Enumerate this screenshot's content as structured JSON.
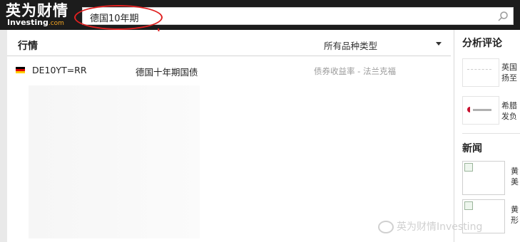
{
  "logo": {
    "chinese": "英为财情",
    "english": "Investing",
    "english_suffix": ".com"
  },
  "search": {
    "value": "德国10年期"
  },
  "markets": {
    "title": "行情",
    "type_filter": "所有品种类型",
    "results": [
      {
        "symbol": "DE10YT=RR",
        "name": "德国十年期国债",
        "type": "债券收益率 - 法兰克福"
      }
    ]
  },
  "analysis": {
    "title": "分析评论",
    "items": [
      {
        "line1": "英国",
        "line2": "扬至"
      },
      {
        "line1": "希腊",
        "line2": "发负"
      }
    ]
  },
  "news": {
    "title": "新闻",
    "items": [
      {
        "line1": "黄",
        "line2": "美"
      },
      {
        "line1": "黄",
        "line2": "形"
      }
    ]
  },
  "watermark": "英为财情Investing",
  "colors": {
    "topbar": "#1c1c1c",
    "accent": "#f5a623",
    "annotation": "#e02020"
  }
}
